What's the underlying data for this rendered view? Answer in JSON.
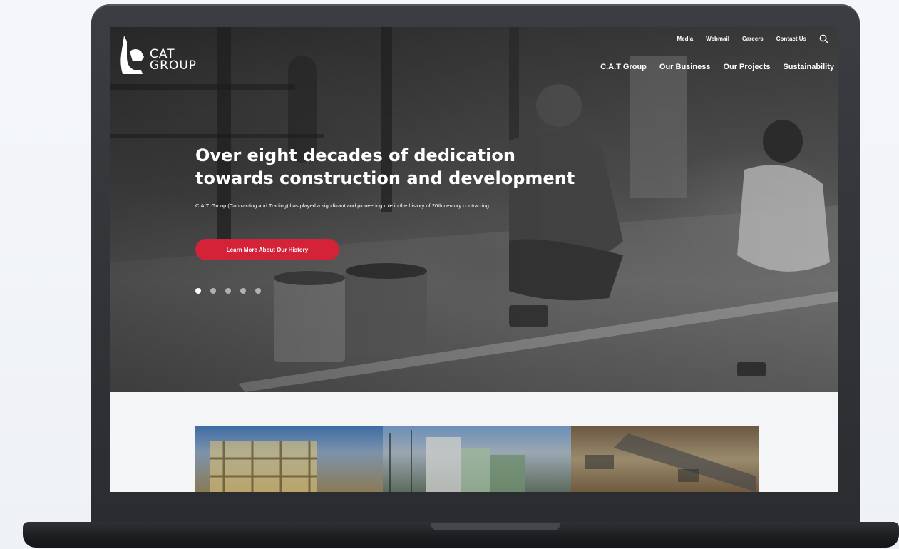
{
  "header": {
    "logo": {
      "line1": "CAT",
      "line2": "GROUP"
    },
    "top_links": [
      "Media",
      "Webmail",
      "Careers",
      "Contact Us"
    ],
    "search_icon": "search-icon",
    "main_nav": [
      "C.A.T Group",
      "Our Business",
      "Our Projects",
      "Sustainability"
    ]
  },
  "hero": {
    "title_line1": "Over eight decades of dedication",
    "title_line2": "towards construction and development",
    "subtitle": "C.A.T. Group (Contracting and Trading) has played a significant and pioneering role in the history of 20th century contracting.",
    "cta_label": "Learn More About Our History",
    "carousel": {
      "total": 5,
      "active": 1
    }
  },
  "colors": {
    "accent": "#d42238",
    "laptop": "#2d2f33"
  }
}
